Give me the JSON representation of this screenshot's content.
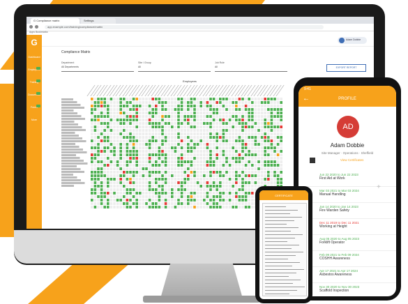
{
  "browser": {
    "tabs": [
      "G  Compliance matrix",
      "Settings"
    ],
    "address": "app.example.com/training/compliance/matrix",
    "bookmarks": "Apps   Bookmarks"
  },
  "app": {
    "logo": "G",
    "sidebar": [
      "Dashboard",
      "Employees",
      "Training",
      "Documents",
      "Forms",
      "More"
    ],
    "user": "Adam Dobbie",
    "breadcrumb": "Compliance Matrix",
    "filters": [
      {
        "label": "Department",
        "value": "All Departments"
      },
      {
        "label": "Site / Group",
        "value": "All"
      },
      {
        "label": "Job Role",
        "value": "All"
      }
    ],
    "report_button": "EXPORT REPORT",
    "matrix_title": "Employees"
  },
  "colors": {
    "accent": "#f7a21b",
    "ok": "#4caf50",
    "expired": "#e53935",
    "empty": "#eeeeee"
  },
  "phone_profile": {
    "time": "9:41",
    "title": "PROFILE",
    "initials": "AD",
    "name": "Adam Dobbie",
    "subtitle": "Site Manager · Operations · Sheffield",
    "link": "View Certificates",
    "records": [
      {
        "date": "Jun 22 2020 to Jun 22 2023",
        "title": "First Aid at Work",
        "status": "ok"
      },
      {
        "date": "Mar 03 2021 to Mar 03 2024",
        "title": "Manual Handling",
        "status": "ok"
      },
      {
        "date": "Jan 14 2020 to Jan 14 2023",
        "title": "Fire Warden Safety",
        "status": "ok"
      },
      {
        "date": "Dec 11 2019 to Dec 11 2021",
        "title": "Working at Height",
        "status": "expired"
      },
      {
        "date": "Aug 05 2020 to Aug 05 2023",
        "title": "Forklift Operator",
        "status": "ok"
      },
      {
        "date": "Feb 09 2021 to Feb 09 2024",
        "title": "COSHH Awareness",
        "status": "ok"
      },
      {
        "date": "Apr 17 2021 to Apr 17 2024",
        "title": "Asbestos Awareness",
        "status": "ok"
      },
      {
        "date": "Nov 30 2020 to Nov 30 2023",
        "title": "Scaffold Inspection",
        "status": "ok"
      }
    ]
  },
  "phone_document": {
    "title": "CERTIFICATE"
  }
}
